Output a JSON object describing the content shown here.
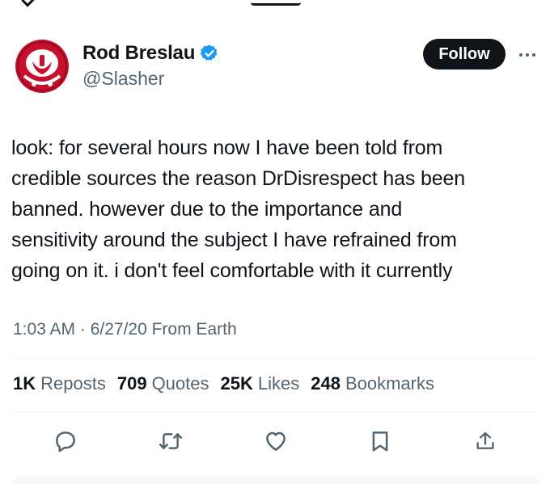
{
  "author": {
    "display_name": "Rod Breslau",
    "handle": "@Slasher",
    "verified": true
  },
  "header": {
    "follow_label": "Follow"
  },
  "tweet": {
    "text": "look: for several hours now I have been told from\ncredible sources the reason DrDisrespect has been\nbanned. however due to the importance and\nsensitivity around the subject I have refrained from\ngoing on it. i don't feel comfortable with it currently",
    "timestamp": "1:03 AM · 6/27/20 From Earth"
  },
  "stats": {
    "reposts": {
      "value": "1K",
      "label": "Reposts"
    },
    "quotes": {
      "value": "709",
      "label": "Quotes"
    },
    "likes": {
      "value": "25K",
      "label": "Likes"
    },
    "bookmarks": {
      "value": "248",
      "label": "Bookmarks"
    }
  },
  "icons": {
    "back": "back-arrow-icon",
    "verified": "verified-badge-icon",
    "more": "more-icon",
    "reply": "reply-icon",
    "repost": "repost-icon",
    "like": "like-icon",
    "bookmark": "bookmark-icon",
    "share": "share-icon"
  },
  "colors": {
    "text_primary": "#0f1419",
    "text_secondary": "#536471",
    "verified_blue": "#1d9bf0",
    "follow_bg": "#0f1419",
    "avatar_red": "#c8102e",
    "divider": "#eff3f4"
  }
}
